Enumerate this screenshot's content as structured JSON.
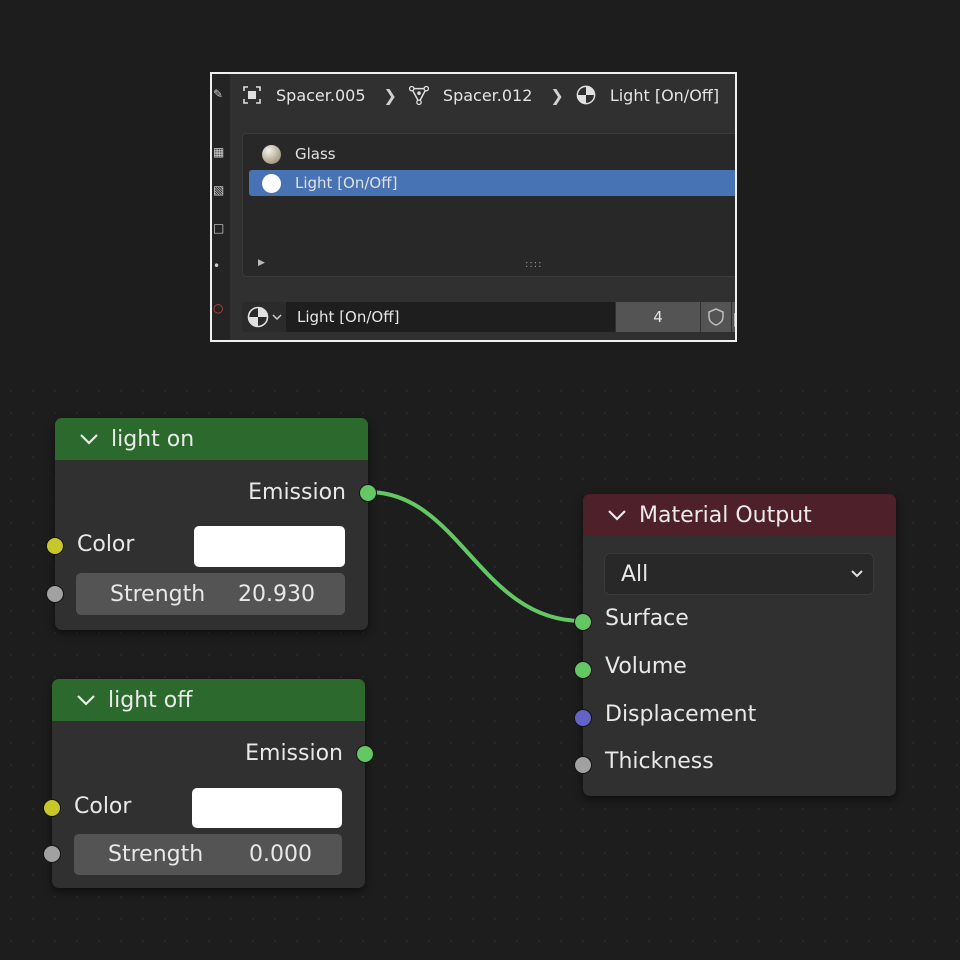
{
  "breadcrumb": {
    "object": "Spacer.005",
    "mesh": "Spacer.012",
    "material": "Light [On/Off]",
    "icons": [
      "object-icon",
      "mesh-icon",
      "material-icon"
    ]
  },
  "material_slots": [
    {
      "name": "Glass",
      "selected": false,
      "color": "#c9c4b6"
    },
    {
      "name": "Light [On/Off]",
      "selected": true,
      "color": "#ffffff"
    }
  ],
  "material_bar": {
    "name": "Light [On/Off]",
    "users": "4"
  },
  "nodes": {
    "light_on": {
      "title": "light on",
      "output": "Emission",
      "color_label": "Color",
      "strength_label": "Strength",
      "strength_value": "20.930",
      "color_value": "#ffffff"
    },
    "light_off": {
      "title": "light off",
      "output": "Emission",
      "color_label": "Color",
      "strength_label": "Strength",
      "strength_value": "0.000",
      "color_value": "#ffffff"
    },
    "material_output": {
      "title": "Material Output",
      "target": "All",
      "inputs": [
        "Surface",
        "Volume",
        "Displacement",
        "Thickness"
      ]
    }
  },
  "colors": {
    "shader_socket": "#63c763",
    "color_socket": "#c7c729",
    "float_socket": "#a1a1a1",
    "vector_socket": "#6363c7",
    "link": "#63c763",
    "selected_slot": "#4772b3"
  }
}
